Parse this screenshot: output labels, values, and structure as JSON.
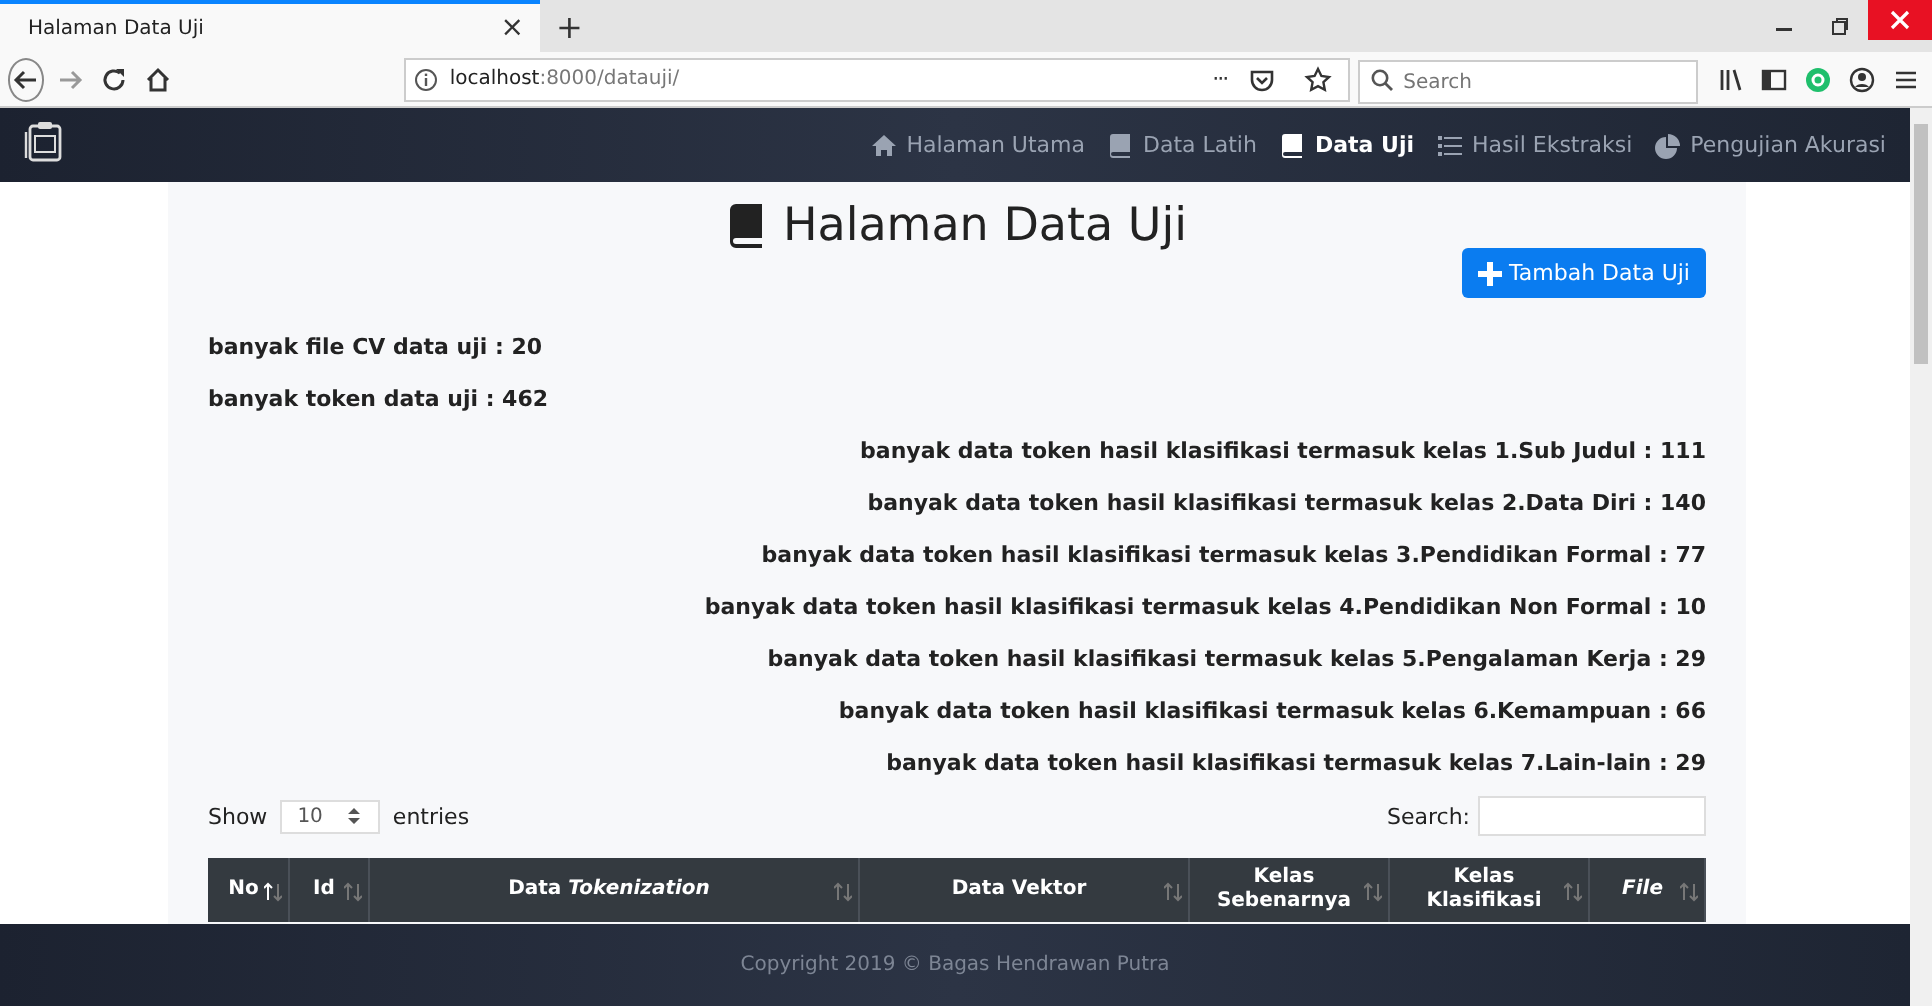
{
  "browser": {
    "tab_title": "Halaman Data Uji",
    "tab_close": "×",
    "new_tab": "+",
    "url_host": "localhost",
    "url_rest": ":8000/datauji/",
    "more": "···",
    "search_placeholder": "Search"
  },
  "navbar": {
    "items": [
      {
        "label": "Halaman Utama",
        "kind": "home",
        "selected": false
      },
      {
        "label": "Data Latih",
        "kind": "book",
        "selected": false
      },
      {
        "label": "Data Uji",
        "kind": "book",
        "selected": true
      },
      {
        "label": "Hasil Ekstraksi",
        "kind": "list",
        "selected": false
      },
      {
        "label": "Pengujian Akurasi",
        "kind": "chart",
        "selected": false
      }
    ]
  },
  "page": {
    "heading": "Halaman Data Uji",
    "add_button": "Tambah Data Uji",
    "summary": [
      "banyak file CV data uji : 20",
      "banyak token data uji : 462"
    ],
    "class_counts": [
      "banyak data token hasil klasifikasi termasuk kelas 1.Sub Judul : 111",
      "banyak data token hasil klasifikasi termasuk kelas 2.Data Diri : 140",
      "banyak data token hasil klasifikasi termasuk kelas 3.Pendidikan Formal : 77",
      "banyak data token hasil klasifikasi termasuk kelas 4.Pendidikan Non Formal : 10",
      "banyak data token hasil klasifikasi termasuk kelas 5.Pengalaman Kerja : 29",
      "banyak data token hasil klasifikasi termasuk kelas 6.Kemampuan : 66",
      "banyak data token hasil klasifikasi termasuk kelas 7.Lain-lain : 29"
    ],
    "table": {
      "show_label": "Show",
      "page_length": "10",
      "entries_label": "entries",
      "search_label": "Search:",
      "columns": [
        {
          "label": "No",
          "sorted": true
        },
        {
          "label": "Id",
          "sorted": false
        },
        {
          "label": "Data *Tokenization*",
          "sorted": false
        },
        {
          "label": "Data Vektor",
          "sorted": false
        },
        {
          "label": "Kelas Sebenarnya",
          "sorted": false
        },
        {
          "label": "Kelas Klasifikasi",
          "sorted": false
        },
        {
          "label": "*File*",
          "sorted": false
        }
      ]
    }
  },
  "footer": {
    "text": "Copyright 2019 © Bagas Hendrawan Putra"
  }
}
